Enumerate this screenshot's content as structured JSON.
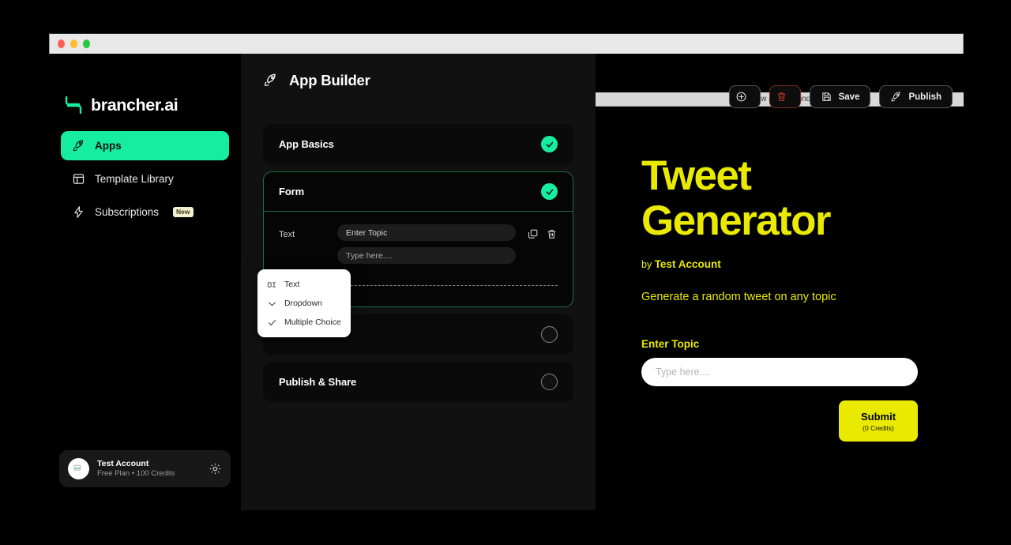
{
  "window": {
    "traffic_lights": [
      "close",
      "minimize",
      "maximize"
    ]
  },
  "sidebar": {
    "brand": "brancher.ai",
    "items": [
      {
        "label": "Apps",
        "icon": "rocket-icon",
        "active": true,
        "badge": ""
      },
      {
        "label": "Template Library",
        "icon": "layout-icon",
        "active": false,
        "badge": ""
      },
      {
        "label": "Subscriptions",
        "icon": "bolt-icon",
        "active": false,
        "badge": "New"
      }
    ],
    "account": {
      "name": "Test Account",
      "plan": "Free Plan • 100 Credits",
      "settings_icon": "gear-icon"
    }
  },
  "builder": {
    "title": "App Builder",
    "title_icon": "rocket-icon",
    "sections": [
      {
        "title": "App Basics",
        "status": "done"
      },
      {
        "title": "Form",
        "status": "done",
        "expanded": true
      },
      {
        "title": "",
        "status": "todo"
      },
      {
        "title": "Publish & Share",
        "status": "todo"
      }
    ],
    "form_field": {
      "label": "Text",
      "name_value": "Enter Topic",
      "placeholder_value": "Type here....",
      "duplicate_icon": "copy-icon",
      "delete_icon": "trash-icon"
    },
    "add_field": {
      "icon": "plus-circle-icon"
    },
    "type_menu": [
      {
        "label": "Text",
        "icon": "text-input-icon"
      },
      {
        "label": "Dropdown",
        "icon": "chevron-down-icon"
      },
      {
        "label": "Multiple Choice",
        "icon": "check-icon"
      }
    ]
  },
  "toolbar": {
    "add_label": "",
    "add_icon": "plus-circle-icon",
    "delete_label": "",
    "delete_icon": "trash-icon",
    "save_label": "Save",
    "save_icon": "floppy-icon",
    "publish_label": "Publish",
    "publish_icon": "rocket-icon"
  },
  "preview": {
    "bar_label": "Preview & Test Window",
    "title_line1": "Tweet",
    "title_line2": "Generator",
    "by_prefix": "by",
    "by_author": "Test Account",
    "description": "Generate a random tweet on any topic",
    "field_label": "Enter Topic",
    "field_placeholder": "Type here....",
    "submit_label": "Submit",
    "submit_credits": "(0 Credits)"
  },
  "colors": {
    "accent_green": "#17eda0",
    "accent_yellow": "#eaea00",
    "danger_red": "#b23a2a",
    "panel": "#111111",
    "card": "#0a0a0a"
  }
}
